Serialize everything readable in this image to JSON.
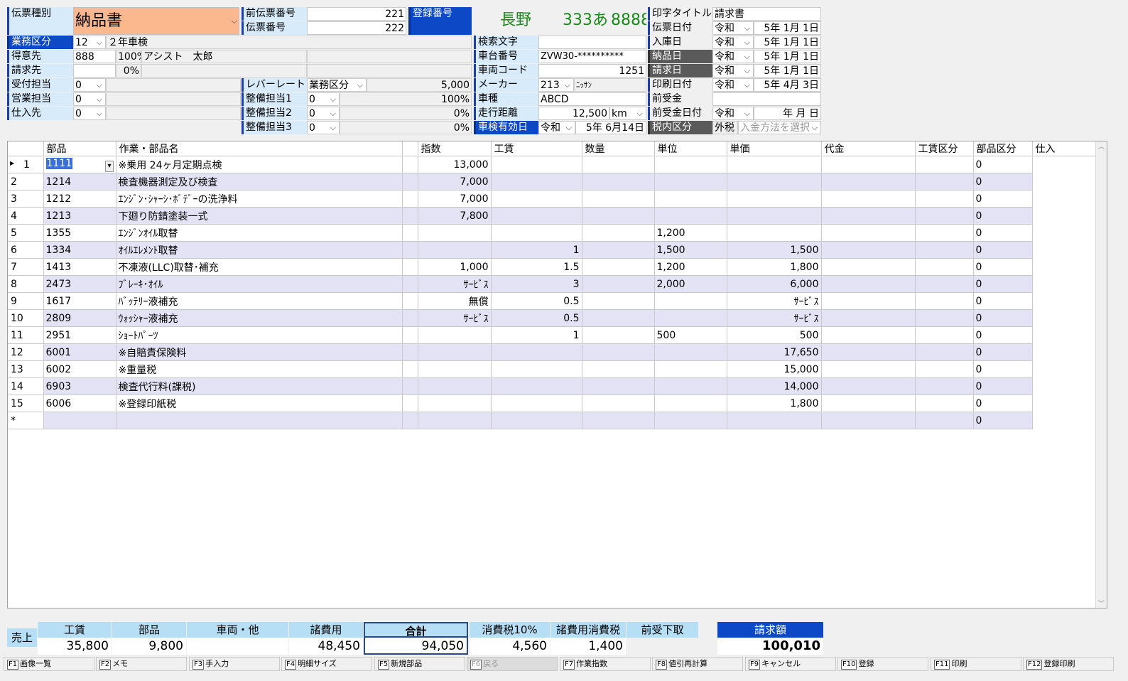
{
  "header": {
    "denpyo_shubetsu_label": "伝票種別",
    "denpyo_shubetsu_value": "納品書",
    "prev_denpyo_label": "前伝票番号",
    "prev_denpyo_value": "221",
    "denpyo_no_label": "伝票番号",
    "denpyo_no_value": "222",
    "touroku_label": "登録番号",
    "plate_region": "長野",
    "plate_class": "333",
    "plate_kana": "あ",
    "plate_number": "8888",
    "print_title_label": "印字タイトル",
    "print_title_value": "請求書",
    "gyomu_label": "業務区分",
    "gyomu_code": "12",
    "gyomu_name": "２年車検",
    "tokui_label": "得意先",
    "tokui_code": "888",
    "tokui_pct": "100%",
    "tokui_name": "アシスト　太郎",
    "seikyu_label": "請求先",
    "seikyu_pct": "0%",
    "uketsuke_label": "受付担当",
    "uketsuke_value": "0",
    "eigyo_label": "営業担当",
    "eigyo_value": "0",
    "shiire_label": "仕入先",
    "shiire_value": "0",
    "labor_rate_label": "レバーレート",
    "labor_rate_select": "業務区分",
    "labor_rate_value": "5,000",
    "seibi1_label": "整備担当1",
    "seibi1_value": "0",
    "seibi1_pct": "100%",
    "seibi2_label": "整備担当2",
    "seibi2_value": "0",
    "seibi2_pct": "0%",
    "seibi3_label": "整備担当3",
    "seibi3_value": "0",
    "seibi3_pct": "0%",
    "kensaku_label": "検索文字",
    "chadai_label": "車台番号",
    "chadai_value": "ZVW30-**********",
    "sharyo_code_label": "車両コード",
    "sharyo_code_value": "1251",
    "maker_label": "メーカー",
    "maker_code": "213",
    "maker_name": "ﾆｯｻﾝ",
    "shashu_label": "車種",
    "shashu_value": "ABCD",
    "soko_label": "走行距離",
    "soko_value": "12,500",
    "soko_unit": "km",
    "shaken_label": "車検有効日",
    "shaken_era": "令和",
    "shaken_date": "5年  6月14日",
    "denpyo_date_label": "伝票日付",
    "nyuko_label": "入庫日",
    "nohin_label": "納品日",
    "seikyu_date_label": "請求日",
    "insatsu_label": "印刷日付",
    "era": "令和",
    "date_1": "5年  1月  1日",
    "date_print": "5年  4月  3日",
    "maeuke_label": "前受金",
    "maeuke_date_label": "前受金日付",
    "maeuke_date": "年    月    日",
    "zei_label": "税内区分",
    "zei_value": "外税",
    "nyukin_placeholder": "入金方法を選択"
  },
  "grid": {
    "columns": [
      "部品",
      "作業・部品名",
      "",
      "指数",
      "工賃",
      "数量",
      "単位",
      "単価",
      "代金",
      "工賃区分",
      "部品区分",
      "仕入"
    ],
    "rows": [
      [
        "1",
        "1111",
        "※乗用 24ヶ月定期点検",
        "",
        "13,000",
        "",
        "",
        "",
        "",
        "",
        "",
        "0"
      ],
      [
        "2",
        "1214",
        "検査機器測定及び検査",
        "",
        "7,000",
        "",
        "",
        "",
        "",
        "",
        "",
        "0"
      ],
      [
        "3",
        "1212",
        "ｴﾝｼﾞﾝ･ｼｬｰｼ･ﾎﾞﾃﾞｰの洗浄料",
        "",
        "7,000",
        "",
        "",
        "",
        "",
        "",
        "",
        "0"
      ],
      [
        "4",
        "1213",
        "下廻り防錆塗装一式",
        "",
        "7,800",
        "",
        "",
        "",
        "",
        "",
        "",
        "0"
      ],
      [
        "5",
        "1355",
        "ｴﾝｼﾞﾝｵｲﾙ取替",
        "",
        "",
        "",
        "",
        "1,200",
        "",
        "",
        "",
        "0"
      ],
      [
        "6",
        "1334",
        "ｵｲﾙｴﾚﾒﾝﾄ取替",
        "",
        "",
        "1",
        "",
        "1,500",
        "1,500",
        "",
        "",
        "0"
      ],
      [
        "7",
        "1413",
        "不凍液(LLC)取替･補充",
        "",
        "1,000",
        "1.5",
        "",
        "1,200",
        "1,800",
        "",
        "",
        "0"
      ],
      [
        "8",
        "2473",
        "ﾌﾞﾚｰｷ･ｵｲﾙ",
        "",
        "ｻｰﾋﾞｽ",
        "3",
        "",
        "2,000",
        "6,000",
        "",
        "",
        "0"
      ],
      [
        "9",
        "1617",
        "ﾊﾞｯﾃﾘｰ液補充",
        "",
        "無償",
        "0.5",
        "",
        "",
        "ｻｰﾋﾞｽ",
        "",
        "",
        "0"
      ],
      [
        "10",
        "2809",
        "ｳｫｯｼｬｰ液補充",
        "",
        "ｻｰﾋﾞｽ",
        "0.5",
        "",
        "",
        "ｻｰﾋﾞｽ",
        "",
        "",
        "0"
      ],
      [
        "11",
        "2951",
        "ｼｮｰﾄﾊﾟｰﾂ",
        "",
        "",
        "1",
        "",
        "500",
        "500",
        "",
        "",
        "0"
      ],
      [
        "12",
        "6001",
        "※自賠責保険料",
        "",
        "",
        "",
        "",
        "",
        "17,650",
        "",
        "",
        "0"
      ],
      [
        "13",
        "6002",
        "※重量税",
        "",
        "",
        "",
        "",
        "",
        "15,000",
        "",
        "",
        "0"
      ],
      [
        "14",
        "6903",
        "検査代行料(課税)",
        "",
        "",
        "",
        "",
        "",
        "14,000",
        "",
        "",
        "0"
      ],
      [
        "15",
        "6006",
        "※登録印紙税",
        "",
        "",
        "",
        "",
        "",
        "1,800",
        "",
        "",
        "0"
      ],
      [
        "*",
        "",
        "",
        "",
        "",
        "",
        "",
        "",
        "",
        "",
        "",
        "0"
      ]
    ]
  },
  "totals": {
    "row_label": "売上",
    "headers": {
      "kochin": "工賃",
      "buhin": "部品",
      "sharyo": "車両・他",
      "shohiyo": "諸費用",
      "gokei": "合計",
      "tax": "消費税10%",
      "shohiyo_tax": "諸費用消費税",
      "maeuke": "前受下取",
      "seikyu": "請求額"
    },
    "values": {
      "kochin": "35,800",
      "buhin": "9,800",
      "sharyo": "",
      "shohiyo": "48,450",
      "gokei": "94,050",
      "tax": "4,560",
      "shohiyo_tax": "1,400",
      "maeuke": "",
      "seikyu": "100,010"
    }
  },
  "fkeys": [
    {
      "key": "F1",
      "label": "画像一覧"
    },
    {
      "key": "F2",
      "label": "メモ"
    },
    {
      "key": "F3",
      "label": "手入力"
    },
    {
      "key": "F4",
      "label": "明細サイズ"
    },
    {
      "key": "F5",
      "label": "新規部品"
    },
    {
      "key": "F6",
      "label": "戻る"
    },
    {
      "key": "F7",
      "label": "作業指数"
    },
    {
      "key": "F8",
      "label": "値引再計算"
    },
    {
      "key": "F9",
      "label": "キャンセル"
    },
    {
      "key": "F10",
      "label": "登録"
    },
    {
      "key": "F11",
      "label": "印刷"
    },
    {
      "key": "F12",
      "label": "登録印刷"
    }
  ],
  "colors": {
    "label_bg": "#d7ebfb",
    "label_dark": "#0d48c6",
    "slip_type_bg": "#fbb88f",
    "plate_text": "#1a8a1a",
    "row_alt": "#e3e3f5"
  }
}
